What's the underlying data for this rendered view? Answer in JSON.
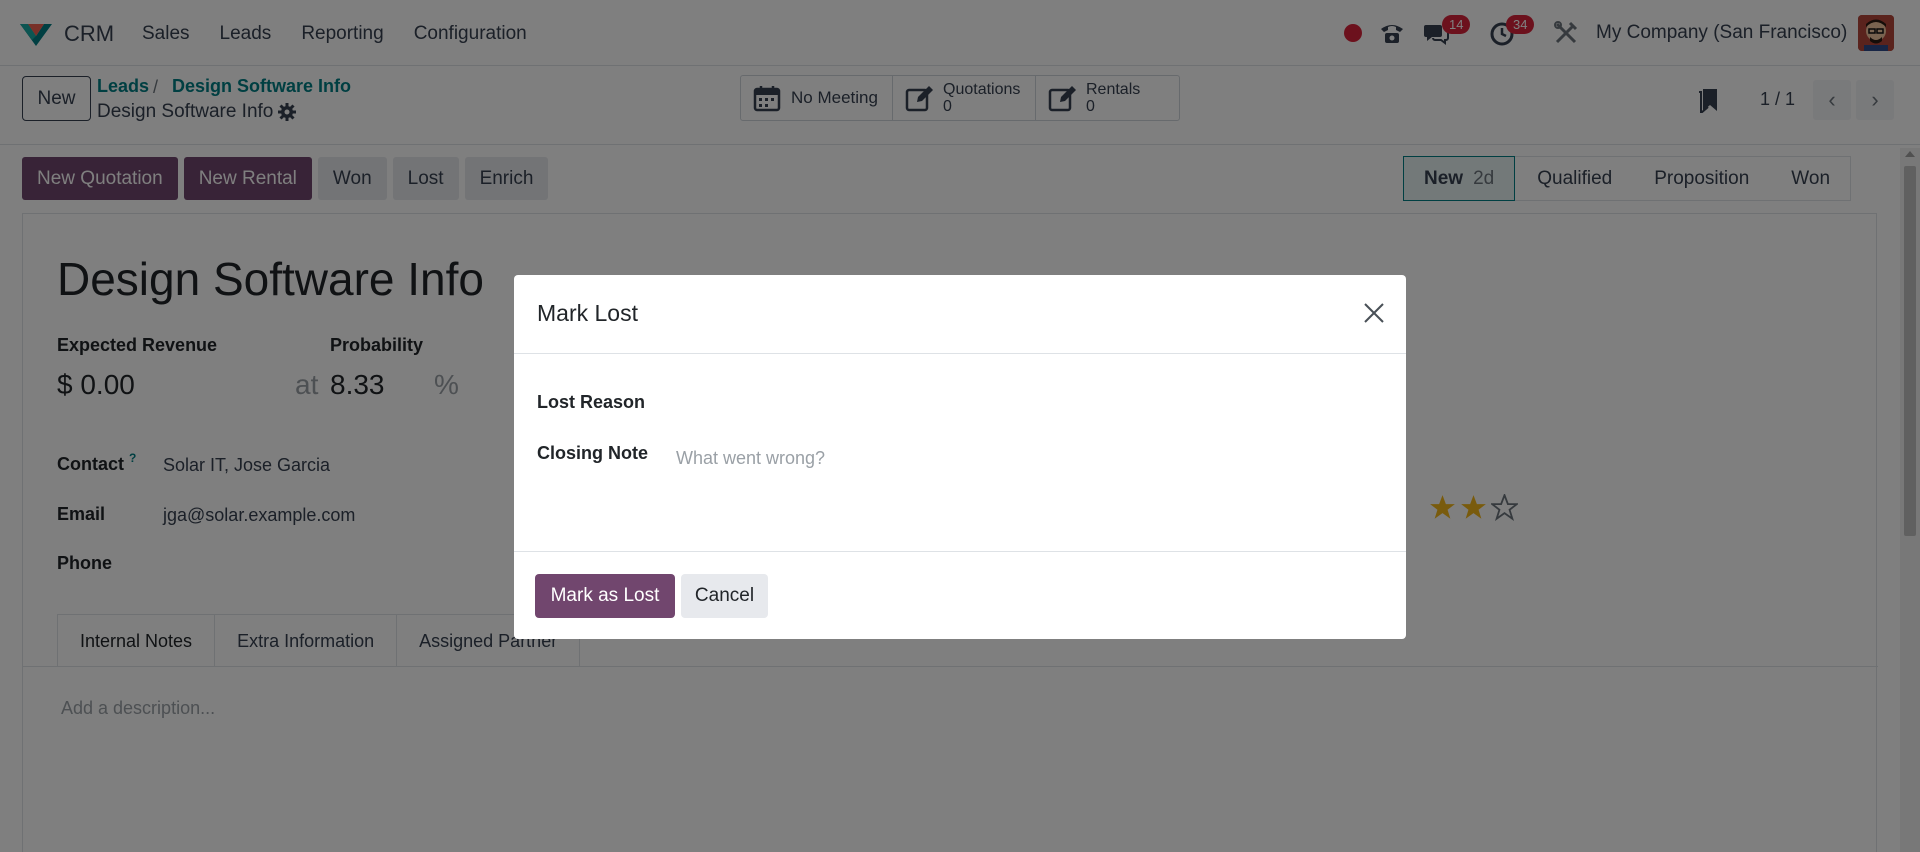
{
  "navbar": {
    "app_name": "CRM",
    "menu": [
      "Sales",
      "Leads",
      "Reporting",
      "Configuration"
    ],
    "messages_badge": "14",
    "activities_badge": "34",
    "company": "My Company (San Francisco)"
  },
  "control_panel": {
    "new_label": "New",
    "breadcrumb": [
      "Leads",
      "Design Software Info"
    ],
    "breadcrumb_sep": "/",
    "current_record": "Design Software Info",
    "smart_buttons": {
      "meeting": "No Meeting",
      "quotations_label": "Quotations",
      "quotations_count": "0",
      "rentals_label": "Rentals",
      "rentals_count": "0"
    },
    "pager": "1 / 1"
  },
  "actions": [
    "New Quotation",
    "New Rental",
    "Won",
    "Lost",
    "Enrich"
  ],
  "stages": {
    "active": "New",
    "active_duration": "2d",
    "others": [
      "Qualified",
      "Proposition",
      "Won"
    ]
  },
  "form": {
    "title": "Design Software Info",
    "expected_revenue_label": "Expected Revenue",
    "expected_revenue": "$ 0.00",
    "at": "at",
    "probability_label": "Probability",
    "probability": "8.33",
    "percent": "%",
    "contact_label": "Contact",
    "contact_help": "?",
    "contact": "Solar IT, Jose Garcia",
    "email_label": "Email",
    "email": "jga@solar.example.com",
    "phone_label": "Phone",
    "priority_stars": 2,
    "tabs": [
      "Internal Notes",
      "Extra Information",
      "Assigned Partner"
    ],
    "description_placeholder": "Add a description..."
  },
  "modal": {
    "title": "Mark Lost",
    "lost_reason_label": "Lost Reason",
    "closing_note_label": "Closing Note",
    "closing_note_placeholder": "What went wrong?",
    "confirm_label": "Mark as Lost",
    "cancel_label": "Cancel"
  },
  "colors": {
    "primary": "#71466e",
    "link": "#017e84",
    "badge": "#d9233a",
    "star": "#f3b71b"
  }
}
